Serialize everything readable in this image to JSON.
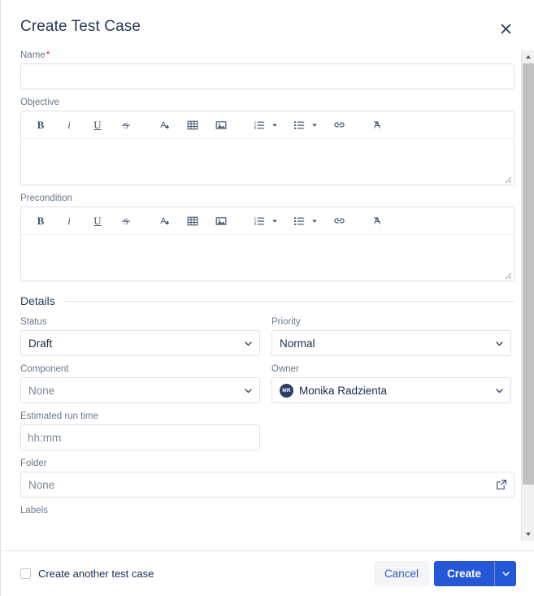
{
  "dialog": {
    "title": "Create Test Case",
    "close_icon": "close-icon"
  },
  "fields": {
    "name": {
      "label": "Name",
      "required_mark": "*",
      "value": "",
      "placeholder": ""
    },
    "objective": {
      "label": "Objective",
      "value": ""
    },
    "precondition": {
      "label": "Precondition",
      "value": ""
    },
    "labels": {
      "label": "Labels"
    }
  },
  "editor_toolbar": {
    "bold": "B",
    "italic": "i",
    "underline": "U",
    "strikethrough": "S",
    "text_color": "A",
    "table": "table-icon",
    "image": "image-icon",
    "ordered_list": "ordered-list-icon",
    "ordered_list_more": "chevron-down-icon",
    "bullet_list": "bullet-list-icon",
    "bullet_list_more": "chevron-down-icon",
    "link": "link-icon",
    "clear_formatting": "clear-formatting-icon"
  },
  "details": {
    "section_title": "Details",
    "status": {
      "label": "Status",
      "value": "Draft"
    },
    "priority": {
      "label": "Priority",
      "value": "Normal"
    },
    "component": {
      "label": "Component",
      "value": "None"
    },
    "owner": {
      "label": "Owner",
      "value": "Monika Radzienta",
      "avatar_initials": "MR"
    },
    "estimated_run_time": {
      "label": "Estimated run time",
      "value": "",
      "placeholder": "hh:mm"
    },
    "folder": {
      "label": "Folder",
      "value": "None",
      "action_icon": "external-link-icon"
    }
  },
  "footer": {
    "create_another_label": "Create another test case",
    "create_another_checked": false,
    "cancel_label": "Cancel",
    "create_label": "Create",
    "create_more_icon": "chevron-down-icon"
  },
  "colors": {
    "primary": "#2458d7",
    "title_text": "#253858",
    "label_text": "#6b778c",
    "border": "#dfe1e6",
    "required": "#de350b",
    "avatar_bg": "#2c3e63"
  }
}
